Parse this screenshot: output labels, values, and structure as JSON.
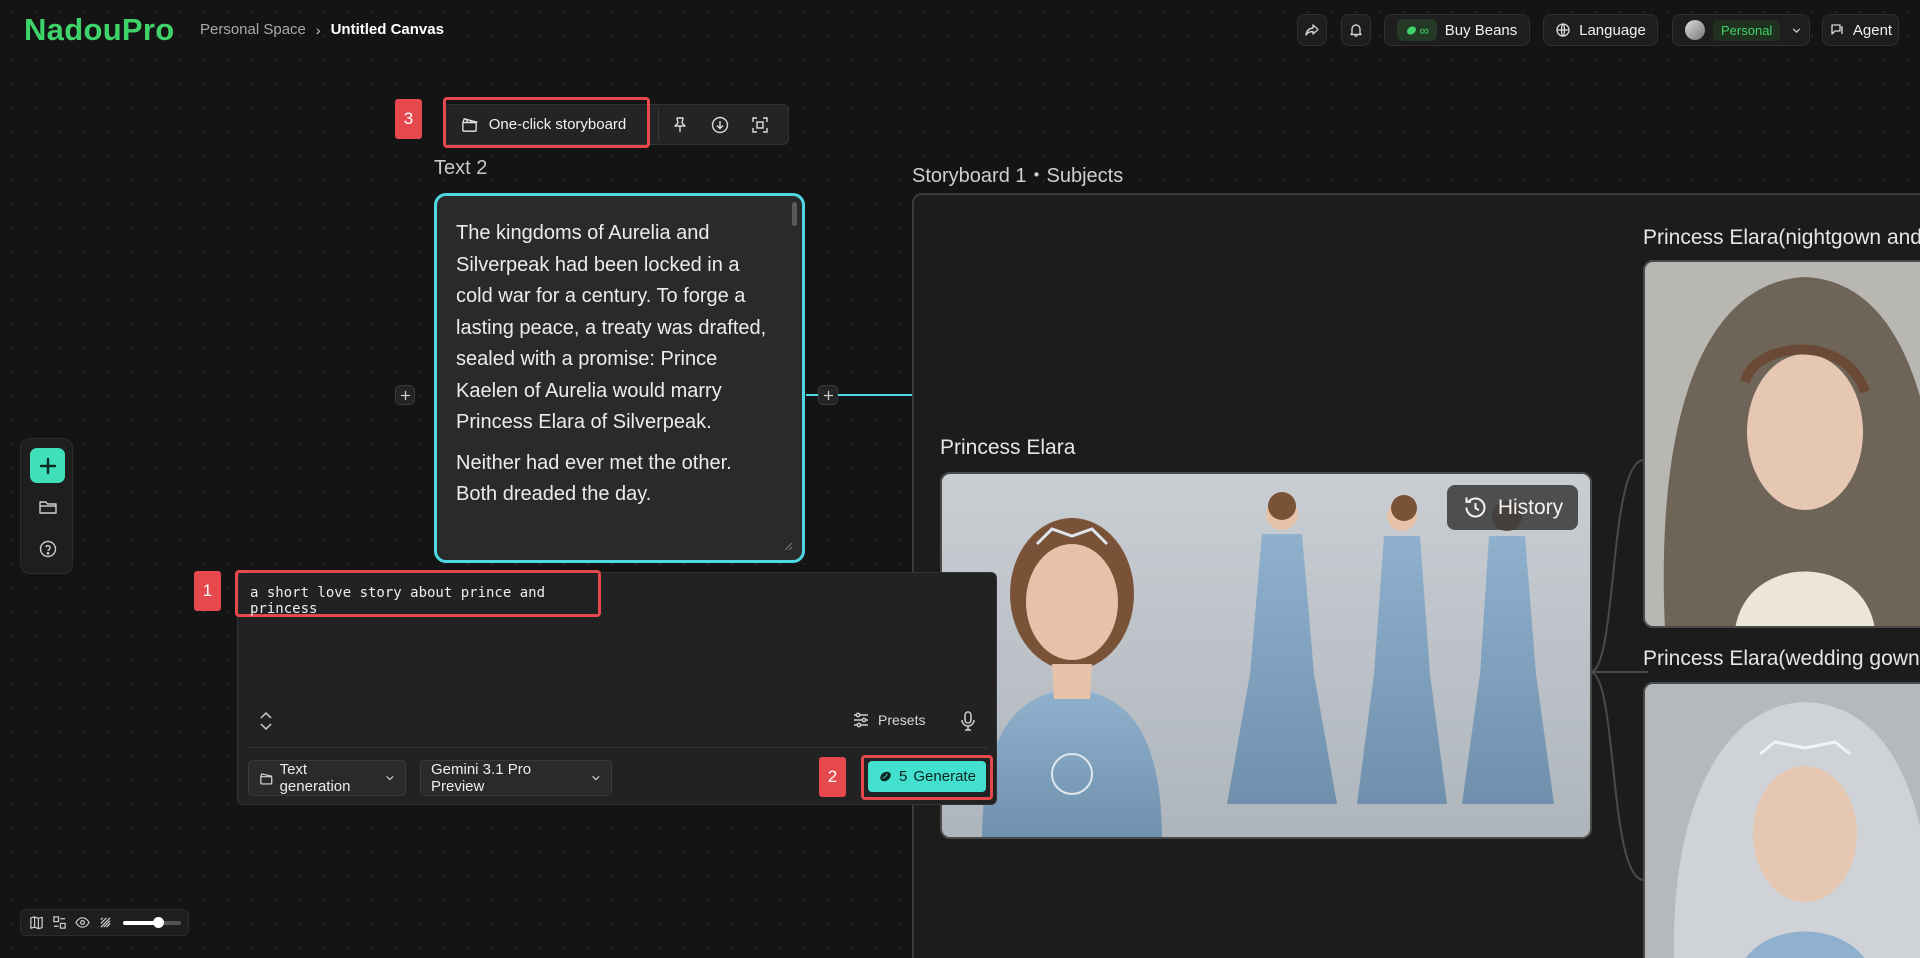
{
  "app": {
    "logo": "NadouPro"
  },
  "breadcrumb": {
    "parent": "Personal Space",
    "separator": "›",
    "current": "Untitled Canvas"
  },
  "header": {
    "buy_beans_label": "Buy Beans",
    "beans_count": "∞",
    "language_label": "Language",
    "account_label": "Personal",
    "agent_label": "Agent"
  },
  "badges": {
    "one": "1",
    "two": "2",
    "three": "3"
  },
  "storyboard_toolbar": {
    "one_click_label": "One-click storyboard"
  },
  "text_node": {
    "title": "Text 2",
    "paragraphs": [
      "The kingdoms of Aurelia and Silverpeak had been locked in a cold war for a century. To forge a lasting peace, a treaty was drafted, sealed with a promise: Prince Kaelen of Aurelia would marry Princess Elara of Silverpeak.",
      "Neither had ever met the other. Both dreaded the day."
    ]
  },
  "prompt": {
    "text": "a short love story about prince and princess",
    "presets_label": "Presets",
    "mode_label": "Text generation",
    "model_label": "Gemini 3.1 Pro Preview",
    "generate_cost": "5",
    "generate_label": "Generate"
  },
  "storyboard": {
    "title": "Storyboard 1・Subjects",
    "main_subject": "Princess Elara",
    "history_label": "History",
    "variant_1": "Princess Elara(nightgown and cloak)",
    "variant_2": "Princess Elara(wedding gown with veil)"
  },
  "colors": {
    "brand_green": "#3fd46a",
    "accent_teal": "#43dfcf",
    "node_outline": "#4fd8e4",
    "annotation_red": "#e5484d"
  },
  "bottom_toolbar": {
    "zoom_fraction": 0.6
  },
  "icons": [
    "share-icon",
    "bell-icon",
    "bean-icon",
    "globe-icon",
    "chevron-down-icon",
    "agent-icon",
    "plus-icon",
    "folder-icon",
    "help-icon",
    "clapperboard-icon",
    "pin-icon",
    "download-icon",
    "focus-icon",
    "expand-icon",
    "sliders-icon",
    "mic-icon",
    "history-icon",
    "map-icon",
    "layout-icon",
    "eye-icon",
    "signal-icon"
  ]
}
